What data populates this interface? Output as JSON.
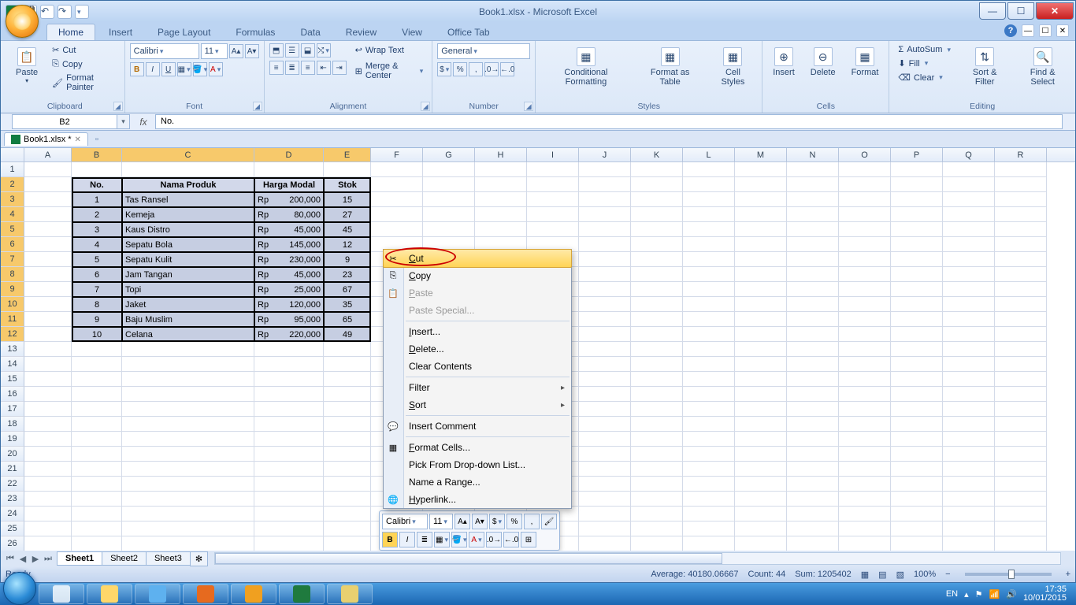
{
  "title": {
    "document": "Book1.xlsx",
    "app": "Microsoft Excel"
  },
  "tabs": {
    "home": "Home",
    "insert": "Insert",
    "page": "Page Layout",
    "formulas": "Formulas",
    "data": "Data",
    "review": "Review",
    "view": "View",
    "office_tab": "Office Tab"
  },
  "clipboard": {
    "paste": "Paste",
    "cut": "Cut",
    "copy": "Copy",
    "fp": "Format Painter",
    "title": "Clipboard"
  },
  "font": {
    "name": "Calibri",
    "size": "11",
    "title": "Font"
  },
  "align": {
    "wrap": "Wrap Text",
    "merge": "Merge & Center",
    "title": "Alignment"
  },
  "number": {
    "format": "General",
    "title": "Number"
  },
  "styles": {
    "cond": "Conditional Formatting",
    "fmt": "Format as Table",
    "cell": "Cell Styles",
    "title": "Styles"
  },
  "cellsg": {
    "insert": "Insert",
    "delete": "Delete",
    "format": "Format",
    "title": "Cells"
  },
  "editing": {
    "sum": "AutoSum",
    "fill": "Fill",
    "clear": "Clear",
    "sort": "Sort & Filter",
    "find": "Find & Select",
    "title": "Editing"
  },
  "namebox": "B2",
  "fx": "fx",
  "formula": "No.",
  "doc_tab": "Book1.xlsx *",
  "columns": [
    "A",
    "B",
    "C",
    "D",
    "E",
    "F",
    "G",
    "H",
    "I",
    "J",
    "K",
    "L",
    "M",
    "N",
    "O",
    "P",
    "Q",
    "R"
  ],
  "col_widths": {
    "A": 60,
    "B": 64,
    "C": 168,
    "D": 88,
    "E": 60,
    "other": 66
  },
  "headers": {
    "no": "No.",
    "produk": "Nama Produk",
    "harga": "Harga Modal",
    "stok": "Stok"
  },
  "curr": "Rp",
  "rows": [
    {
      "no": "1",
      "produk": "Tas Ransel",
      "harga": "200,000",
      "stok": "15"
    },
    {
      "no": "2",
      "produk": "Kemeja",
      "harga": "80,000",
      "stok": "27"
    },
    {
      "no": "3",
      "produk": "Kaus Distro",
      "harga": "45,000",
      "stok": "45"
    },
    {
      "no": "4",
      "produk": "Sepatu Bola",
      "harga": "145,000",
      "stok": "12"
    },
    {
      "no": "5",
      "produk": "Sepatu Kulit",
      "harga": "230,000",
      "stok": "9"
    },
    {
      "no": "6",
      "produk": "Jam Tangan",
      "harga": "45,000",
      "stok": "23"
    },
    {
      "no": "7",
      "produk": "Topi",
      "harga": "25,000",
      "stok": "67"
    },
    {
      "no": "8",
      "produk": "Jaket",
      "harga": "120,000",
      "stok": "35"
    },
    {
      "no": "9",
      "produk": "Baju Muslim",
      "harga": "95,000",
      "stok": "65"
    },
    {
      "no": "10",
      "produk": "Celana",
      "harga": "220,000",
      "stok": "49"
    }
  ],
  "ctx": {
    "cut": "Cut",
    "copy": "Copy",
    "paste": "Paste",
    "pspec": "Paste Special...",
    "ins": "Insert...",
    "del": "Delete...",
    "clr": "Clear Contents",
    "filter": "Filter",
    "sort": "Sort",
    "cmt": "Insert Comment",
    "fcells": "Format Cells...",
    "pick": "Pick From Drop-down List...",
    "range": "Name a Range...",
    "hyper": "Hyperlink..."
  },
  "mini": {
    "font": "Calibri",
    "size": "11"
  },
  "sheets": {
    "s1": "Sheet1",
    "s2": "Sheet2",
    "s3": "Sheet3"
  },
  "status": {
    "ready": "Ready",
    "avg": "Average: 40180.06667",
    "count": "Count: 44",
    "sum": "Sum: 1205402",
    "zoom": "100%",
    "minus": "−",
    "plus": "+"
  },
  "tray": {
    "lang": "EN",
    "time": "17:35",
    "date": "10/01/2015"
  }
}
